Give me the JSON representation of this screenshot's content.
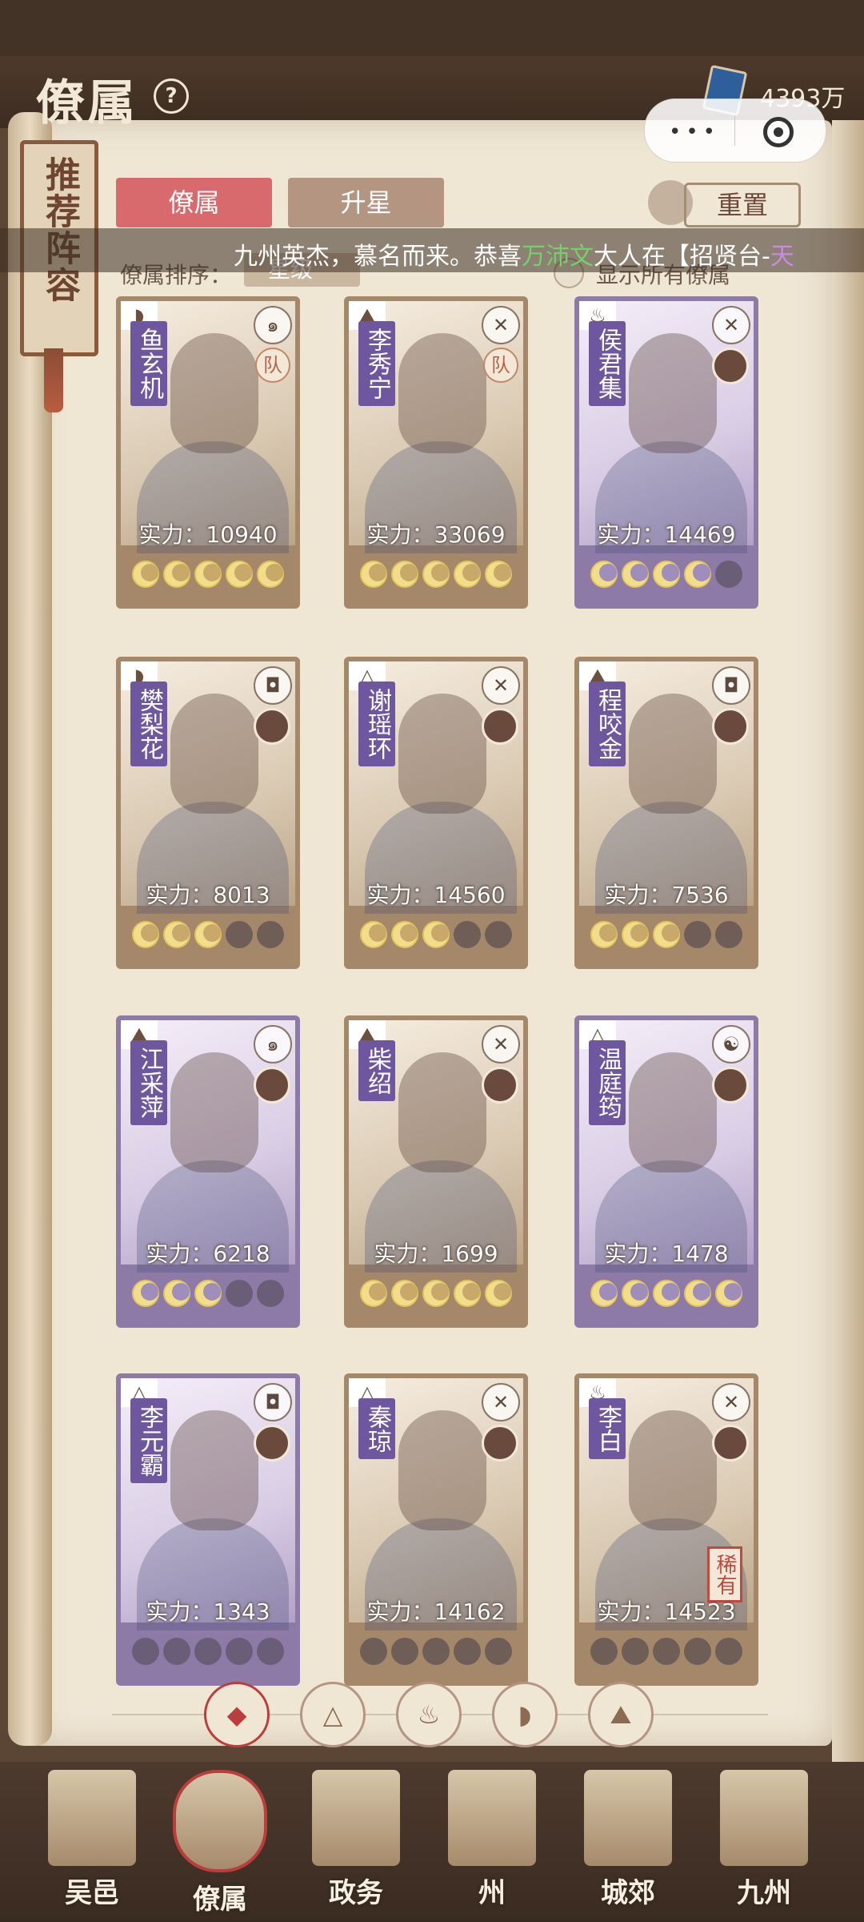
{
  "header": {
    "title": "僚属",
    "help_icon": "?",
    "currency_value": "4393万"
  },
  "recommend_lineup": "推荐阵容",
  "tabs": [
    {
      "label": "僚属",
      "active": true
    },
    {
      "label": "升星",
      "active": false
    }
  ],
  "reset_label": "重置",
  "banner": {
    "prefix": "九州英杰，慕名而来。恭喜",
    "player": "万沛文",
    "middle": "大人在【招贤台-",
    "suffix": "天"
  },
  "sort": {
    "label": "僚属排序：",
    "value": "星级"
  },
  "show_all_label": "显示所有僚属",
  "cards": [
    {
      "name": "鱼玄机",
      "power": "实力：10940",
      "rarity": "gold",
      "type_icon": "fan",
      "role_icon": "swirl",
      "badge": "队",
      "stars_on": 5,
      "rare": ""
    },
    {
      "name": "李秀宁",
      "power": "实力：33069",
      "rarity": "gold",
      "type_icon": "mountain",
      "role_icon": "swords",
      "badge": "队",
      "stars_on": 5,
      "rare": ""
    },
    {
      "name": "侯君集",
      "power": "实力：14469",
      "rarity": "purple",
      "type_icon": "gourd",
      "role_icon": "swords",
      "badge": "",
      "stars_on": 4,
      "rare": ""
    },
    {
      "name": "樊梨花",
      "power": "实力：8013",
      "rarity": "gold",
      "type_icon": "fan",
      "role_icon": "shield",
      "badge": "",
      "stars_on": 3,
      "rare": ""
    },
    {
      "name": "谢瑶环",
      "power": "实力：14560",
      "rarity": "gold",
      "type_icon": "bell",
      "role_icon": "swords",
      "badge": "",
      "stars_on": 3,
      "rare": ""
    },
    {
      "name": "程咬金",
      "power": "实力：7536",
      "rarity": "gold",
      "type_icon": "mountain",
      "role_icon": "shield",
      "badge": "",
      "stars_on": 3,
      "rare": ""
    },
    {
      "name": "江采萍",
      "power": "实力：6218",
      "rarity": "purple",
      "type_icon": "mountain",
      "role_icon": "swirl",
      "badge": "",
      "stars_on": 3,
      "rare": ""
    },
    {
      "name": "柴绍",
      "power": "实力：1699",
      "rarity": "gold",
      "type_icon": "mountain",
      "role_icon": "swords",
      "badge": "",
      "stars_on": 5,
      "rare": ""
    },
    {
      "name": "温庭筠",
      "power": "实力：1478",
      "rarity": "purple",
      "type_icon": "bell",
      "role_icon": "yin-yang",
      "badge": "",
      "stars_on": 5,
      "rare": ""
    },
    {
      "name": "李元霸",
      "power": "实力：1343",
      "rarity": "purple",
      "type_icon": "bell",
      "role_icon": "shield",
      "badge": "",
      "stars_on": 0,
      "rare": ""
    },
    {
      "name": "秦琼",
      "power": "实力：14162",
      "rarity": "gold",
      "type_icon": "bell",
      "role_icon": "swords",
      "badge": "",
      "stars_on": 0,
      "rare": ""
    },
    {
      "name": "李白",
      "power": "实力：14523",
      "rarity": "gold",
      "type_icon": "gourd",
      "role_icon": "swords",
      "badge": "",
      "stars_on": 0,
      "rare": "稀有"
    }
  ],
  "filters": [
    {
      "icon": "diamond-grid-icon",
      "active": true
    },
    {
      "icon": "bell-icon",
      "active": false
    },
    {
      "icon": "gourd-icon",
      "active": false
    },
    {
      "icon": "fan-icon",
      "active": false
    },
    {
      "icon": "mountain-icon",
      "active": false
    }
  ],
  "nav": [
    {
      "label": "吴邑",
      "active": false
    },
    {
      "label": "僚属",
      "active": true
    },
    {
      "label": "政务",
      "active": false
    },
    {
      "label": "州",
      "active": false
    },
    {
      "label": "城郊",
      "active": false
    },
    {
      "label": "九州",
      "active": false
    }
  ],
  "colors": {
    "tab_active": "#d86a6e",
    "tab_inactive": "#b49581",
    "banner_player": "#73d06a",
    "banner_suffix": "#c98ae0",
    "gold_card": "#a58769",
    "purple_card": "#8e7aa6"
  }
}
